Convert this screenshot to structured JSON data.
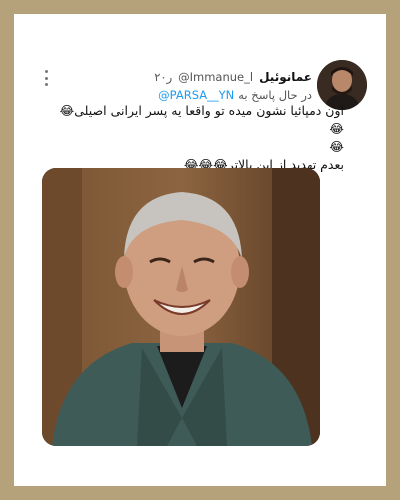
{
  "tweet": {
    "display_name": "عمانوئیل",
    "handle": "@Immanue_l",
    "time": "۲۰ر",
    "replying_to_label": "در حال پاسخ به",
    "replying_to_handle": "@PARSA__YN",
    "text_line1": "اون دمپائیا نشون میده تو واقعا یه پسر ایرانی اصیلی😂😂",
    "text_line2": "😂",
    "text_line3": "بعدم تهدید از این بالاتر😂😂😂"
  },
  "colors": {
    "frame": "#b5a27a",
    "mention": "#1d9bf0",
    "background": "#ffffff"
  }
}
